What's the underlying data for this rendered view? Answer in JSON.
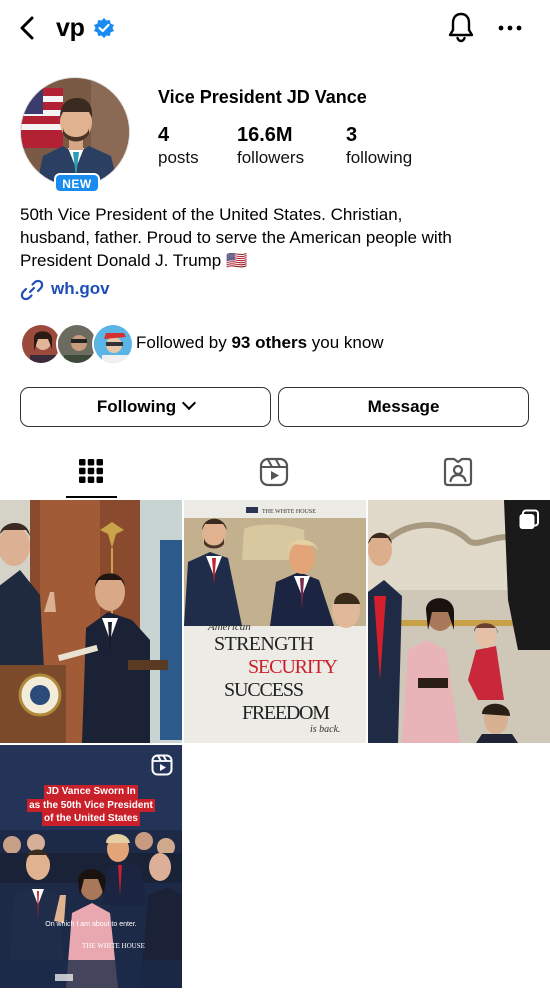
{
  "header": {
    "username": "vp",
    "back_icon": "chevron-left-icon",
    "verified_icon": "verified-badge-icon",
    "bell_icon": "bell-icon",
    "more_icon": "more-horizontal-icon"
  },
  "profile": {
    "new_badge": "NEW",
    "display_name": "Vice President JD Vance",
    "stats": [
      {
        "num": "4",
        "label": "posts"
      },
      {
        "num": "16.6M",
        "label": "followers"
      },
      {
        "num": "3",
        "label": "following"
      }
    ],
    "bio_lines": [
      "50th Vice President of the United States. Christian,",
      "husband, father. Proud to serve the American people with",
      "President Donald J. Trump 🇺🇸"
    ],
    "link": "wh.gov",
    "mutuals": {
      "prefix": "Followed by ",
      "count": "93 others",
      "suffix": " you know"
    }
  },
  "actions": {
    "following_label": "Following",
    "message_label": "Message"
  },
  "tabs": [
    {
      "name": "grid-icon",
      "active": true
    },
    {
      "name": "reels-icon",
      "active": false
    },
    {
      "name": "tagged-icon",
      "active": false
    }
  ],
  "posts": {
    "post2": {
      "brand": "THE WHITE HOUSE",
      "line1": "American",
      "line2": "STRENGTH",
      "line3": "SECURITY",
      "line4": "SUCCESS",
      "line5": "FREEDOM",
      "line6": "is back."
    },
    "post4": {
      "caption_line1": "JD Vance Sworn In",
      "caption_line2": "as the 50th Vice President",
      "caption_line3": "of the United States",
      "subtitle": "On which I am about to enter.",
      "brand": "THE WHITE HOUSE"
    }
  },
  "colors": {
    "accent": "#1a8cf0",
    "link": "#1f4fb6",
    "red_caption": "#c9202a"
  }
}
